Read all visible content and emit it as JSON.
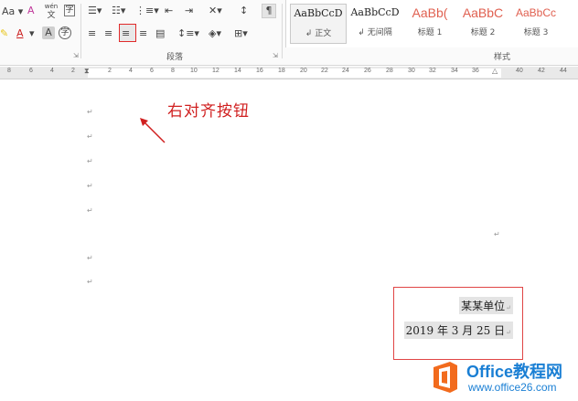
{
  "ribbon": {
    "font_icons": {
      "font_size_label": "Aa",
      "clear_format": "A",
      "phonetic": "wén",
      "phonetic_sub": "文",
      "font_color": "A",
      "highlight": "ab",
      "enclose_char": "A",
      "char_border": "字"
    },
    "paragraph_group_label": "段落",
    "styles_group_label": "样式",
    "styles": [
      {
        "sample": "AaBbCcD",
        "name": "正文"
      },
      {
        "sample": "AaBbCcD",
        "name": "无间隔"
      },
      {
        "sample": "AaBb(",
        "name": "标题 1"
      },
      {
        "sample": "AaBbC",
        "name": "标题 2"
      },
      {
        "sample": "AaBbCc",
        "name": "标题 3"
      }
    ]
  },
  "ruler": {
    "left_ticks": [
      "8",
      "6",
      "4",
      "2"
    ],
    "right_ticks": [
      "2",
      "4",
      "6",
      "8",
      "10",
      "12",
      "14",
      "16",
      "18",
      "20",
      "22",
      "24",
      "26",
      "28",
      "30",
      "32",
      "34",
      "36",
      "38",
      "40",
      "42",
      "44"
    ]
  },
  "document": {
    "annotation": "右对齐按钮",
    "paragraph_mark": "↵",
    "signature": {
      "line1": "某某单位",
      "line2": "2019 年 3 月 25 日"
    }
  },
  "logo": {
    "title": "Office教程网",
    "url": "www.office26.com"
  },
  "colors": {
    "annotation_red": "#d02020",
    "logo_blue": "#1a7fd4",
    "logo_orange": "#f26b1d"
  }
}
